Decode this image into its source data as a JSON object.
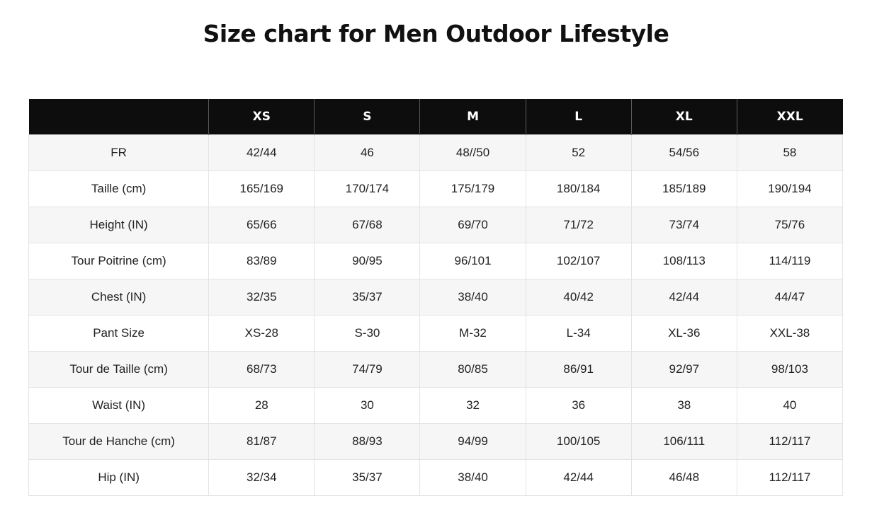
{
  "title": "Size chart for Men Outdoor Lifestyle",
  "table": {
    "headers": [
      "",
      "XS",
      "S",
      "M",
      "L",
      "XL",
      "XXL"
    ],
    "rows": [
      {
        "label": "FR",
        "values": [
          "42/44",
          "46",
          "48//50",
          "52",
          "54/56",
          "58"
        ]
      },
      {
        "label": "Taille (cm)",
        "values": [
          "165/169",
          "170/174",
          "175/179",
          "180/184",
          "185/189",
          "190/194"
        ]
      },
      {
        "label": "Height (IN)",
        "values": [
          "65/66",
          "67/68",
          "69/70",
          "71/72",
          "73/74",
          "75/76"
        ]
      },
      {
        "label": "Tour Poitrine (cm)",
        "values": [
          "83/89",
          "90/95",
          "96/101",
          "102/107",
          "108/113",
          "114/119"
        ]
      },
      {
        "label": "Chest (IN)",
        "values": [
          "32/35",
          "35/37",
          "38/40",
          "40/42",
          "42/44",
          "44/47"
        ]
      },
      {
        "label": "Pant Size",
        "values": [
          "XS-28",
          "S-30",
          "M-32",
          "L-34",
          "XL-36",
          "XXL-38"
        ]
      },
      {
        "label": "Tour de Taille (cm)",
        "values": [
          "68/73",
          "74/79",
          "80/85",
          "86/91",
          "92/97",
          "98/103"
        ]
      },
      {
        "label": "Waist (IN)",
        "values": [
          "28",
          "30",
          "32",
          "36",
          "38",
          "40"
        ]
      },
      {
        "label": "Tour de Hanche (cm)",
        "values": [
          "81/87",
          "88/93",
          "94/99",
          "100/105",
          "106/111",
          "112/117"
        ]
      },
      {
        "label": "Hip (IN)",
        "values": [
          "32/34",
          "35/37",
          "38/40",
          "42/44",
          "46/48",
          "112/117"
        ]
      }
    ]
  }
}
